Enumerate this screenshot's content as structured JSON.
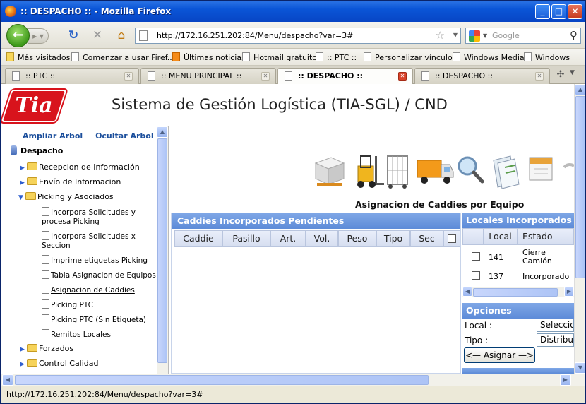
{
  "window": {
    "title": ":: DESPACHO :: - Mozilla Firefox"
  },
  "nav": {
    "url": "http://172.16.251.202:84/Menu/despacho?var=3#",
    "search_placeholder": "Google"
  },
  "bookmarks": [
    {
      "label": "Más visitados"
    },
    {
      "label": "Comenzar a usar Firef..."
    },
    {
      "label": "Últimas noticias"
    },
    {
      "label": "Hotmail gratuito"
    },
    {
      "label": ":: PTC ::"
    },
    {
      "label": "Personalizar vínculos"
    },
    {
      "label": "Windows Media"
    },
    {
      "label": "Windows"
    }
  ],
  "tabs": [
    {
      "label": ":: PTC ::"
    },
    {
      "label": ":: MENU PRINCIPAL ::"
    },
    {
      "label": ":: DESPACHO ::"
    },
    {
      "label": ":: DESPACHO ::"
    }
  ],
  "header": {
    "logo_text": "Tia",
    "title": "Sistema de Gestión Logística (TIA-SGL) / CND"
  },
  "sidebar": {
    "expand_link": "Ampliar Arbol",
    "hide_link": "Ocultar Arbol",
    "root": "Despacho",
    "nodes": [
      {
        "label": "Recepcion de Información"
      },
      {
        "label": "Envío de Informacion"
      },
      {
        "label": "Picking y Asociados"
      },
      {
        "label": "Forzados"
      },
      {
        "label": "Control Calidad"
      }
    ],
    "leaves": [
      {
        "line1": "Incorpora Solicitudes y",
        "line2": "procesa Picking"
      },
      {
        "line1": "Incorpora Solicitudes x",
        "line2": "Seccion"
      },
      {
        "line1": "Imprime etiquetas Picking"
      },
      {
        "line1": "Tabla Asignacion de Equipos"
      },
      {
        "line1": "Asignacion de Caddies"
      },
      {
        "line1": "Picking PTC"
      },
      {
        "line1": "Picking PTC (Sin Etiqueta)"
      },
      {
        "line1": "Remitos Locales"
      }
    ]
  },
  "main": {
    "title": "Asignacion de Caddies por Equipo",
    "left_panel": {
      "title": "Caddies Incorporados Pendientes",
      "columns": [
        "Caddie",
        "Pasillo",
        "Art.",
        "Vol.",
        "Peso",
        "Tipo",
        "Sec"
      ]
    },
    "right_panel": {
      "title": "Locales Incorporados",
      "columns": [
        "Local",
        "Estado"
      ],
      "rows": [
        {
          "local": "141",
          "estado_1": "Cierre",
          "estado_2": "Camión"
        },
        {
          "local": "137",
          "estado_1": "Incorporado",
          "estado_2": ""
        }
      ]
    },
    "options": {
      "title": "Opciones",
      "local_label": "Local :",
      "local_value": "Seleccione",
      "tipo_label": "Tipo :",
      "tipo_value": "Distribución",
      "assign_button": "<— Asignar —>"
    }
  },
  "status": {
    "text": "http://172.16.251.202:84/Menu/despacho?var=3#"
  }
}
